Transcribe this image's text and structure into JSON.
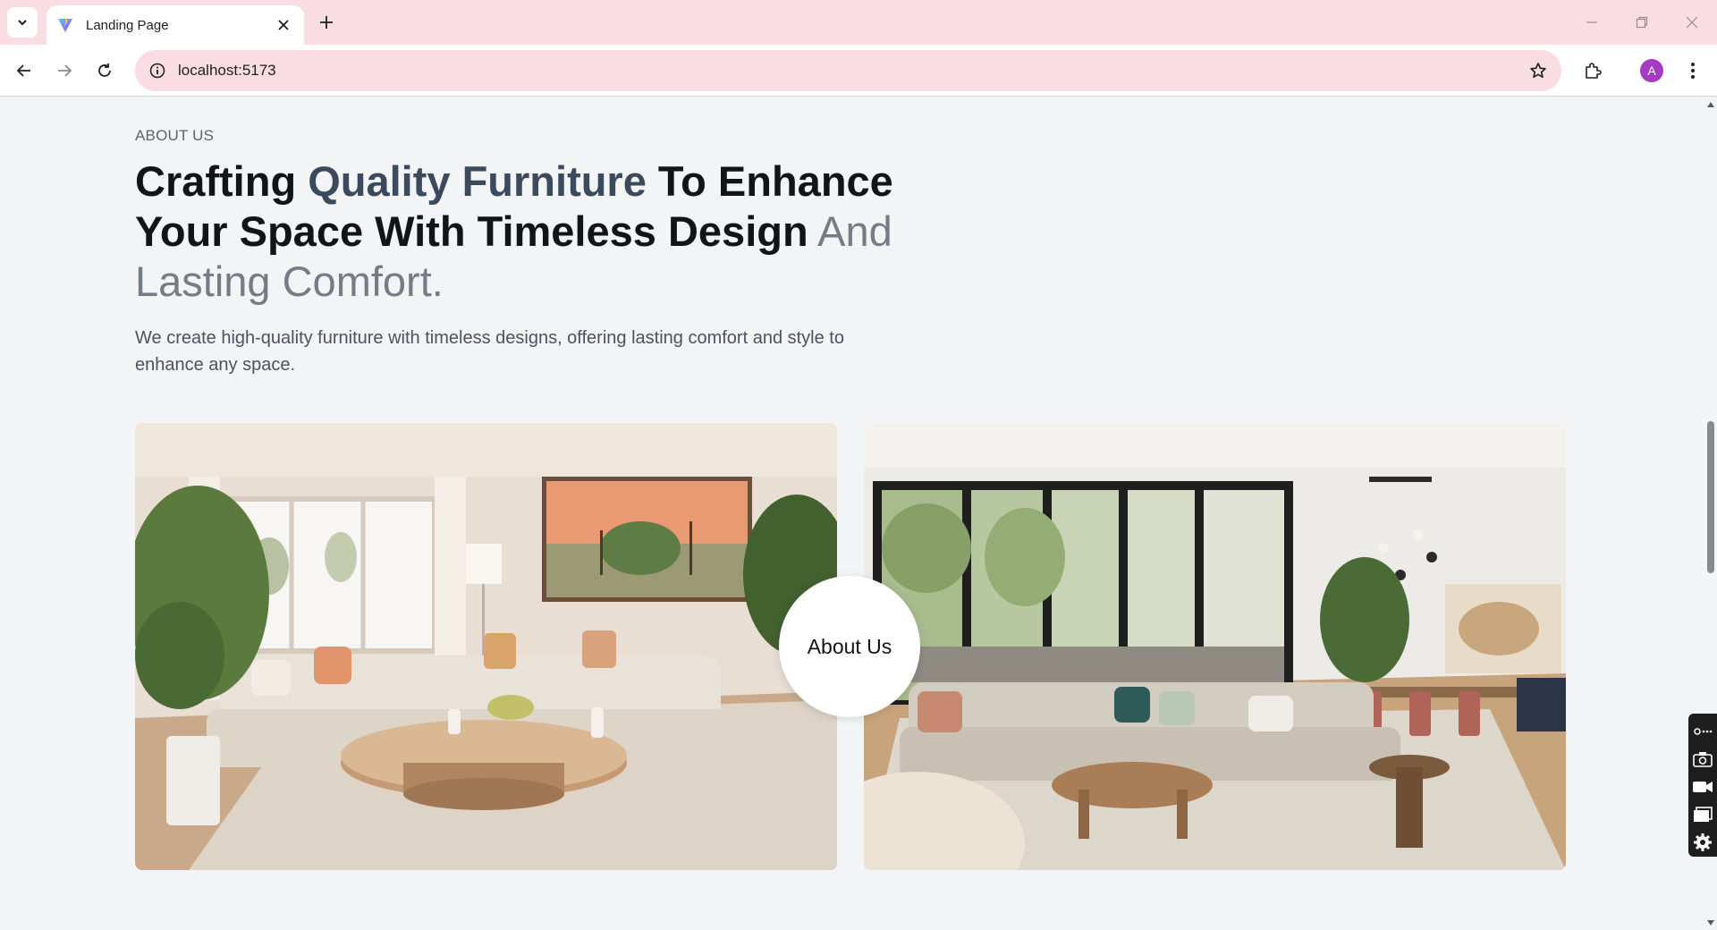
{
  "browser": {
    "tab_title": "Landing Page",
    "url": "localhost:5173",
    "profile_initial": "A",
    "colors": {
      "chrome_pink": "#f9dde3",
      "avatar": "#a43bc2"
    }
  },
  "about": {
    "eyebrow": "ABOUT US",
    "headline": {
      "part1": "Crafting ",
      "part2": "Quality Furniture",
      "part3": " To Enhance Your Space With Timeless Design",
      "part4": " And Lasting Comfort."
    },
    "description": "We create high-quality furniture with timeless designs, offering lasting comfort and style to enhance any space.",
    "badge_label": "About Us",
    "images": [
      "living-room-with-palm-painting",
      "living-room-with-sliding-glass-doors"
    ]
  },
  "icons": {
    "tab_menu": "chevron-down-icon",
    "favicon": "vite-logo-icon",
    "close": "close-icon",
    "new_tab": "plus-icon",
    "back": "arrow-left-icon",
    "forward": "arrow-right-icon",
    "reload": "reload-icon",
    "site_info": "info-icon",
    "bookmark": "star-icon",
    "extensions": "puzzle-icon",
    "menu": "kebab-menu-icon"
  }
}
